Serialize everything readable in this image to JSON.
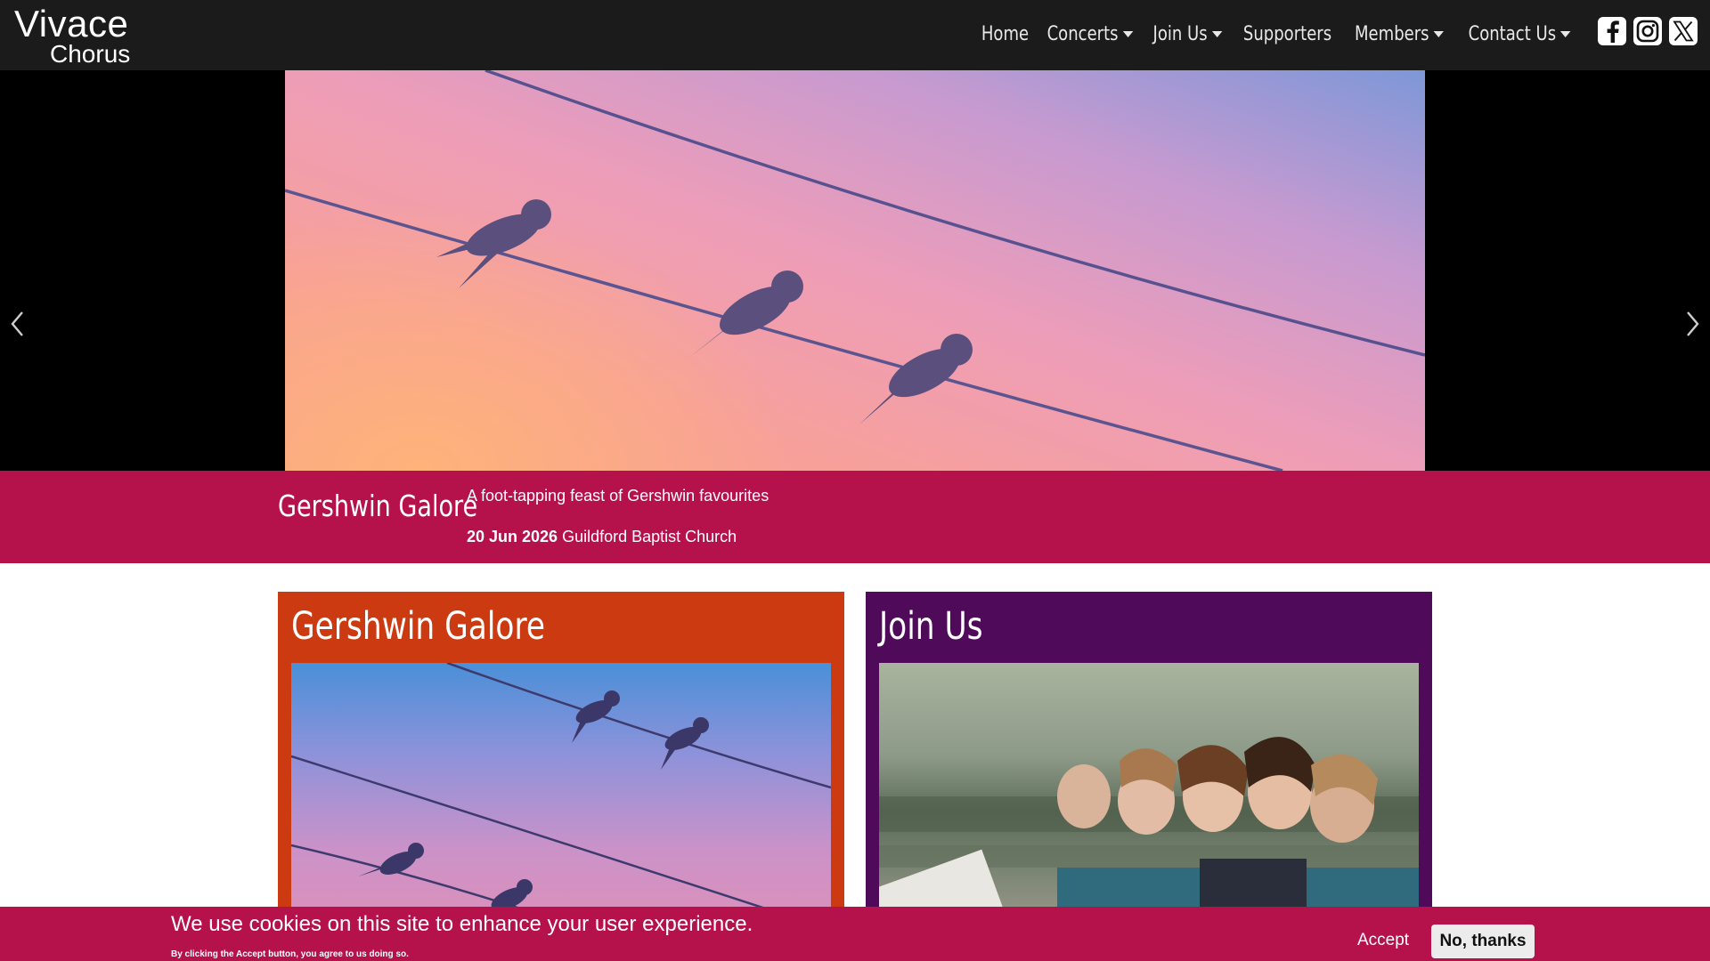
{
  "brand": {
    "line1": "Vivace",
    "line2": "Chorus"
  },
  "nav": {
    "items": [
      {
        "label": "Home",
        "dropdown": false
      },
      {
        "label": "Concerts",
        "dropdown": true
      },
      {
        "label": "Join Us",
        "dropdown": true
      },
      {
        "label": "Supporters",
        "dropdown": false
      },
      {
        "label": "Members",
        "dropdown": true
      },
      {
        "label": "Contact Us",
        "dropdown": true
      }
    ],
    "social_icons": [
      "facebook-icon",
      "instagram-icon",
      "x-icon"
    ]
  },
  "hero": {
    "controls": {
      "prev_icon": "chevron-left-icon",
      "next_icon": "chevron-right-icon"
    }
  },
  "event": {
    "title": "Gershwin Galore",
    "tagline": "A foot-tapping feast of Gershwin favourites",
    "date": "20 Jun 2026",
    "venue": " Guildford Baptist Church"
  },
  "cards": [
    {
      "title": "Gershwin Galore",
      "color": "#cb3a10"
    },
    {
      "title": "Join Us",
      "color": "#4f0a59"
    }
  ],
  "cookie": {
    "message": "We use cookies on this site to enhance your user experience.",
    "sub": "By clicking the Accept button, you agree to us doing so.",
    "accept_label": "Accept",
    "decline_label": "No, thanks"
  },
  "colors": {
    "navbar": "#1b1b1b",
    "accent": "#b5114a",
    "card_orange": "#cb3a10",
    "card_purple": "#4f0a59"
  }
}
